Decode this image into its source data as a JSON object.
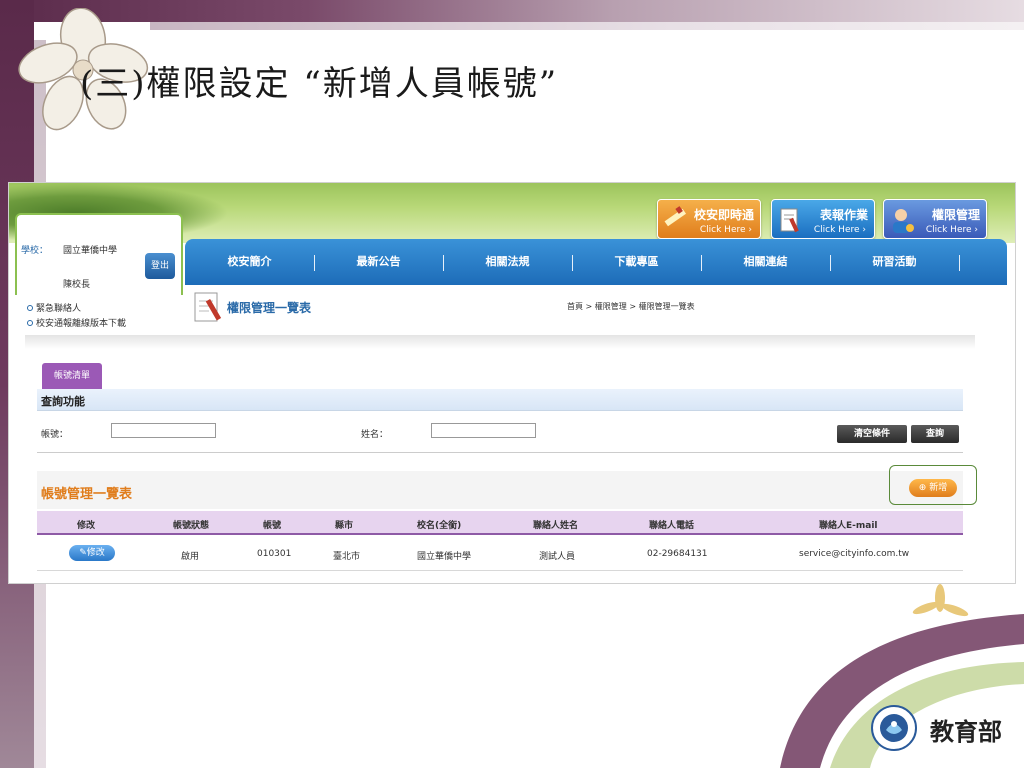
{
  "slide": {
    "title": "(三)權限設定 “新增人員帳號”",
    "ministry_name": "教育部"
  },
  "site": {
    "quick_links": [
      {
        "label": "校安即時通",
        "sub": "Click Here ›"
      },
      {
        "label": "表報作業",
        "sub": "Click Here ›"
      },
      {
        "label": "權限管理",
        "sub": "Click Here ›"
      }
    ],
    "user": {
      "school_label": "學校：",
      "school_name": "國立華僑中學",
      "role": "陳校長",
      "logout_label": "登出"
    },
    "side_links": [
      "緊急聯絡人",
      "校安通報離線版本下載"
    ],
    "nav": [
      "校安簡介",
      "最新公告",
      "相關法規",
      "下載專區",
      "相關連結",
      "研習活動"
    ]
  },
  "page": {
    "title": "權限管理一覽表",
    "breadcrumb": "首頁 > 權限管理 > 權限管理一覽表"
  },
  "query": {
    "tab_label": "帳號清單",
    "section_title": "查詢功能",
    "account_label": "帳號：",
    "name_label": "姓名：",
    "account_value": "",
    "name_value": "",
    "clear_button": "清空條件",
    "search_button": "查詢"
  },
  "list": {
    "title": "帳號管理一覽表",
    "add_button": "新增",
    "columns": [
      "修改",
      "帳號狀態",
      "帳號",
      "縣市",
      "校名(全銜)",
      "聯絡人姓名",
      "聯絡人電話",
      "聯絡人E-mail"
    ],
    "rows": [
      {
        "edit": "修改",
        "status": "啟用",
        "account": "010301",
        "city": "臺北市",
        "school": "國立華僑中學",
        "contact": "測試人員",
        "phone": "02-29684131",
        "email": "service@cityinfo.com.tw"
      }
    ]
  },
  "colors": {
    "nav_blue": "#1d6cb8",
    "accent_orange": "#e07d1c",
    "tab_purple": "#9b59b6",
    "header_purple": "#e7d4ef",
    "banner_green": "#9cc45c"
  }
}
